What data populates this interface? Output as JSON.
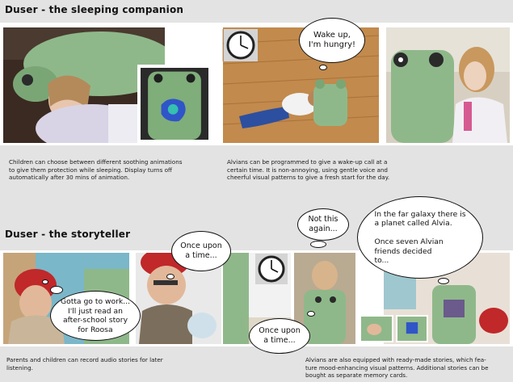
{
  "sections": {
    "sleeping": {
      "title": "Duser - the sleeping companion",
      "caption_left": "Children can choose between different soothing animations\nto give them protection while sleeping. Display turns off\nautomatically after 30 mins of animation.",
      "caption_right": "Alvians can be programmed to give a wake-up call at a\ncertain time. It is non-annoying, using gentle voice and\ncheerful visual patterns to give a fresh start for the day.",
      "bubble_wake": "Wake up,\nI'm hungry!"
    },
    "storyteller": {
      "title": "Duser - the storyteller",
      "caption_left": "Parents and children can record audio stories for later\nlistening.",
      "caption_right": "Alvians are also equipped with ready-made stories, which fea-\nture mood-enhancing visual patterns. Additional stories can be\nbought as separate memory cards.",
      "bubble_work": "Gotta go to work...\nI'll just read an\nafter-school story\nfor Roosa",
      "bubble_upon1": "Once upon\na time...",
      "bubble_notthis": "Not this\nagain...",
      "bubble_upon2": "Once upon\na time...",
      "bubble_galaxy": "In the far galaxy there is\na planet called Alvia.\n\nOnce seven Alvian\nfriends decided\nto..."
    }
  },
  "colors": {
    "background": "#e3e3e3",
    "band": "#ffffff",
    "plush_green": "#8fb88a",
    "hat_red": "#c0282a"
  },
  "icons": [
    "wall-clock-icon"
  ]
}
